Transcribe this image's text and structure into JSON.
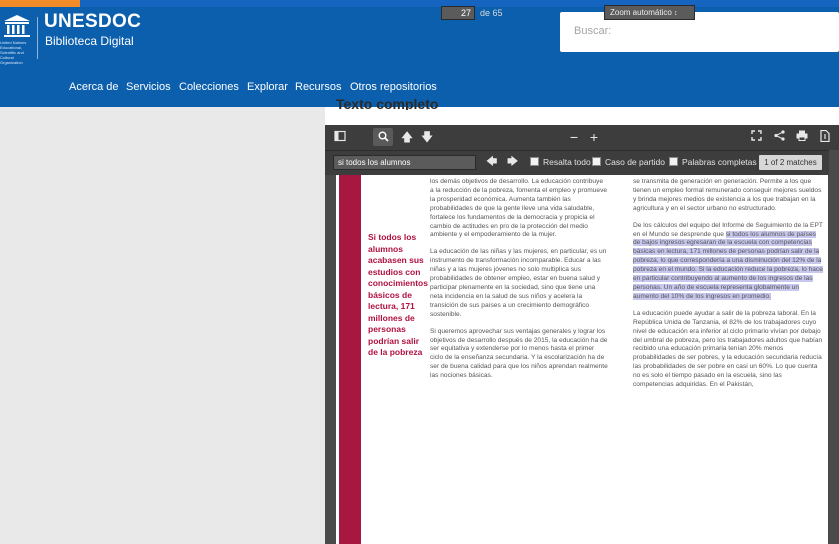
{
  "header": {
    "brand": "UNESDOC",
    "subbrand": "Biblioteca Digital",
    "logo_caption": "United Nations Educational, Scientific and Cultural Organization",
    "search_placeholder": "Buscar:"
  },
  "nav": [
    "Acerca de",
    "Servicios",
    "Colecciones",
    "Explorar",
    "Recursos",
    "Otros repositorios"
  ],
  "section_title": "Texto completo",
  "viewer": {
    "page_number": "27",
    "page_of": "de 65",
    "zoom": "Zoom automático",
    "find_query": "si todos los alumnos",
    "opt_highlight_all": "Resalta todo",
    "opt_match_case": "Caso de partido",
    "opt_whole_words": "Palabras completas",
    "matches": "1 of 2 matches"
  },
  "icons": {
    "sidebar": "sidebar-toggle-icon",
    "search": "search-icon",
    "prev": "arrow-up-icon",
    "next": "arrow-down-icon",
    "zoom_out": "minus-icon",
    "zoom_in": "plus-icon",
    "fullscreen": "fullscreen-icon",
    "share": "share-icon",
    "print": "print-icon",
    "download": "download-icon"
  },
  "document": {
    "pull_quote": "Si todos los alumnos acabasen sus estudios con conocimientos básicos de lectura, 171 millones de personas podrían salir de la pobreza",
    "col1": [
      "los demás objetivos de desarrollo. La educación contribuye a la reducción de la pobreza, fomenta el empleo y promueve la prosperidad económica. Aumenta también las probabilidades de que la gente lleve una vida saludable, fortalece los fundamentos de la democracia y propicia el cambio de actitudes en pro de la protección del medio ambiente y el empoderamiento de la mujer.",
      "La educación de las niñas y las mujeres, en particular, es un instrumento de transformación incomparable. Educar a las niñas y a las mujeres jóvenes no solo multiplica sus probabilidades de obtener empleo, estar en buena salud y participar plenamente en la sociedad, sino que tiene una neta incidencia en la salud de sus niños y acelera la transición de sus países a un crecimiento demográfico sostenible.",
      "Si queremos aprovechar sus ventajas generales y lograr los objetivos de desarrollo después de 2015, la educación ha de ser equitativa y extenderse por lo menos hasta el primer ciclo de la enseñanza secundaria. Y la escolarización ha de ser de buena calidad para que los niños aprendan realmente las nociones básicas."
    ],
    "col2_p1": "se transmita de generación en generación. Permite a los que tienen un empleo formal remunerado conseguir mejores sueldos y brinda mejores medios de existencia a los que trabajan en la agricultura y en el sector urbano no estructurado.",
    "col2_p2_before": "De los cálculos del equipo del Informe de Seguimiento de la EPT en el Mundo se desprende que ",
    "col2_p2_hl": "si todos los alumnos de países de bajos ingresos egresaran de la escuela con competencias básicas en lectura, 171 millones de personas podrían salir de la pobreza, lo que correspondería a una disminución del 12% de la pobreza en el mundo. Si la educación reduce la pobreza, lo hace en particular contribuyendo al aumento de los ingresos de las personas. Un año de escuela representa globalmente un aumento del 10% de los ingresos en promedio.",
    "col2_p3": "La educación puede ayudar a salir de la pobreza laboral. En la República Unida de Tanzania, el 82% de los trabajadores cuyo nivel de educación era inferior al ciclo primario vivían por debajo del umbral de pobreza, pero los trabajadores adultos que habían recibido una educación primaria tenían 20% menos probabilidades de ser pobres, y la educación secundaria reducía las probabilidades de ser pobre en casi un 60%. Lo que cuenta no es solo el tiempo pasado en la escuela, sino las competencias adquiridas. En el Pakistán,"
  },
  "colors": {
    "header": "#0b5fad",
    "accent_orange": "#f28c28",
    "stripe": "#a8173f",
    "highlight": "#c8c8ee"
  }
}
